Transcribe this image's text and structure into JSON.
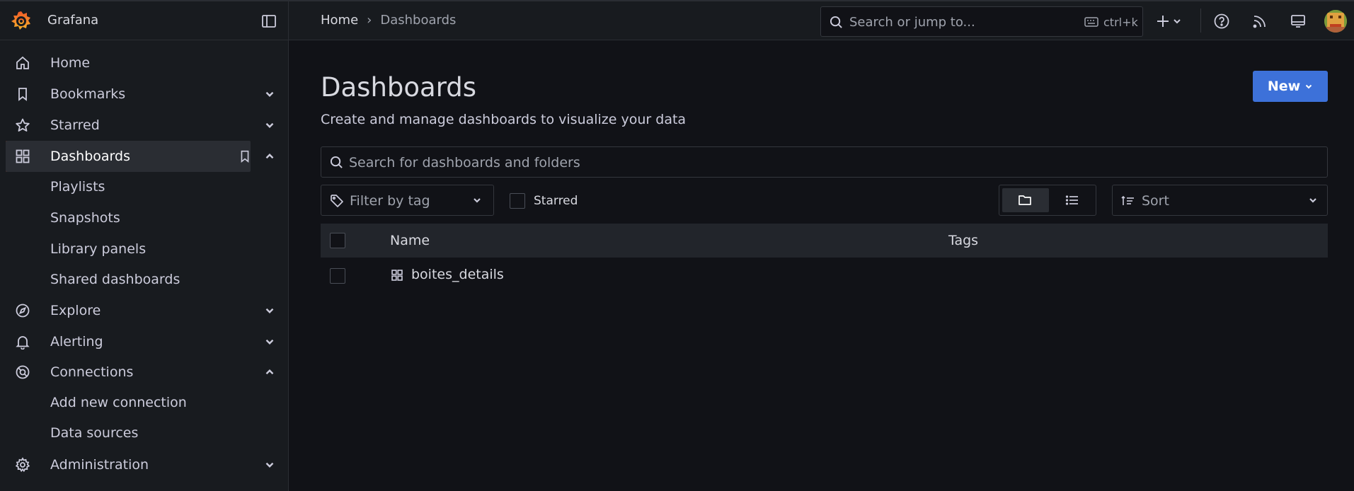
{
  "topbar": {
    "brand": "Grafana",
    "breadcrumb": {
      "home": "Home",
      "separator": "›",
      "current": "Dashboards"
    },
    "search": {
      "placeholder": "Search or jump to...",
      "shortcut": "ctrl+k"
    },
    "icons": [
      "grafana-logo-icon",
      "dock-menu-icon",
      "search-icon",
      "keyboard-icon",
      "plus-icon",
      "chevron-down-icon",
      "help-icon",
      "rss-icon",
      "kiosk-icon",
      "avatar"
    ]
  },
  "sidebar": {
    "items": [
      {
        "label": "Home",
        "icon": "home-icon"
      },
      {
        "label": "Bookmarks",
        "icon": "bookmark-icon",
        "chevron": "down"
      },
      {
        "label": "Starred",
        "icon": "star-icon",
        "chevron": "down"
      },
      {
        "label": "Dashboards",
        "icon": "apps-icon",
        "chevron": "up",
        "active": true,
        "children": [
          "Playlists",
          "Snapshots",
          "Library panels",
          "Shared dashboards"
        ]
      },
      {
        "label": "Explore",
        "icon": "compass-icon",
        "chevron": "down"
      },
      {
        "label": "Alerting",
        "icon": "bell-icon",
        "chevron": "down"
      },
      {
        "label": "Connections",
        "icon": "connections-icon",
        "chevron": "up",
        "children": [
          "Add new connection",
          "Data sources"
        ]
      },
      {
        "label": "Administration",
        "icon": "gear-icon",
        "chevron": "down"
      }
    ]
  },
  "main": {
    "title": "Dashboards",
    "subtitle": "Create and manage dashboards to visualize your data",
    "new_button": "New",
    "search_placeholder": "Search for dashboards and folders",
    "filter_tag_placeholder": "Filter by tag",
    "starred_label": "Starred",
    "sort_placeholder": "Sort",
    "view_mode": "folders",
    "table": {
      "columns": [
        "Name",
        "Tags"
      ],
      "rows": [
        {
          "name": "boites_details",
          "tags": ""
        }
      ]
    }
  },
  "colors": {
    "accent": "#3d71d9",
    "active_indicator": "#f05a28",
    "background": "#111217",
    "panel": "#181b1f"
  }
}
